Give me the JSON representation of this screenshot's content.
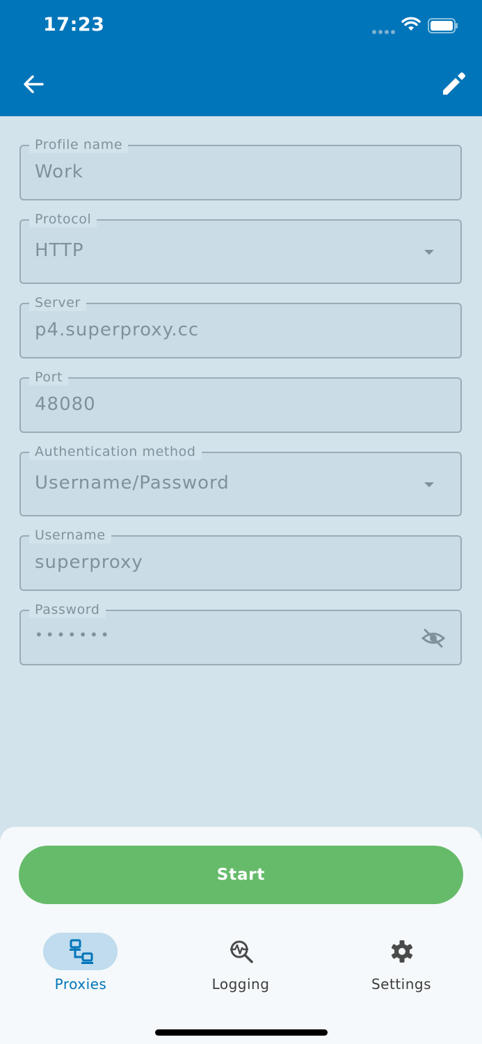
{
  "status_bar": {
    "time": "17:23"
  },
  "app_bar": {
    "back_icon": "arrow-left-icon",
    "edit_icon": "pencil-icon"
  },
  "form": {
    "profile_name": {
      "label": "Profile name",
      "value": "Work"
    },
    "protocol": {
      "label": "Protocol",
      "value": "HTTP"
    },
    "server": {
      "label": "Server",
      "value": "p4.superproxy.cc"
    },
    "port": {
      "label": "Port",
      "value": "48080"
    },
    "auth_method": {
      "label": "Authentication method",
      "value": "Username/Password"
    },
    "username": {
      "label": "Username",
      "value": "superproxy"
    },
    "password": {
      "label": "Password",
      "value": "•••••••"
    }
  },
  "actions": {
    "start_label": "Start"
  },
  "bottom_nav": {
    "items": [
      {
        "label": "Proxies",
        "icon": "network-icon",
        "active": true
      },
      {
        "label": "Logging",
        "icon": "search-activity-icon",
        "active": false
      },
      {
        "label": "Settings",
        "icon": "gear-icon",
        "active": false
      }
    ]
  },
  "colors": {
    "app_bar": "#0175b9",
    "background": "#d2e3eb",
    "start_button": "#66bb6a",
    "active_nav": "#0175b9",
    "active_pill": "#c0dcee"
  }
}
